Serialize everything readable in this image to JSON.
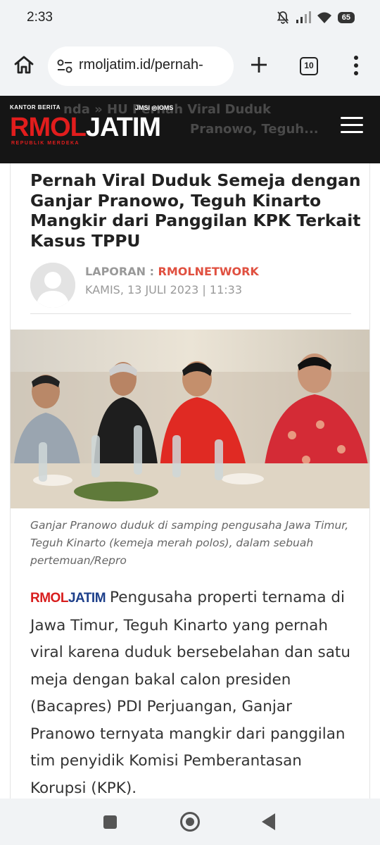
{
  "status_bar": {
    "time": "2:33",
    "battery": "65",
    "icons": [
      "bell-off-icon",
      "signal-icon",
      "wifi-icon",
      "battery-icon"
    ]
  },
  "browser": {
    "url": "rmoljatim.id/pernah-",
    "tab_count": "10",
    "icons": [
      "home-icon",
      "site-settings-icon",
      "new-tab-icon",
      "tabs-icon",
      "more-menu-icon"
    ]
  },
  "site_header": {
    "logo_tagline_top": "KANTOR BERITA",
    "logo_rmol": "RMOL",
    "logo_jatim": "JATIM",
    "logo_tagline_bottom": "REPUBLIK MERDEKA",
    "logo_partner": "JMSI ◎IOMS",
    "breadcrumb_behind": "nda  »  HU       Pernah Viral Duduk",
    "breadcrumb_behind_2": "Pranowo, Teguh...",
    "menu_icon": "hamburger-menu-icon"
  },
  "article": {
    "title": "Pernah Viral Duduk Semeja dengan Ganjar Pranowo, Teguh Kinarto Mangkir dari Panggilan KPK Terkait Kasus TPPU",
    "byline_label": "LAPORAN : ",
    "author": "RMOLNETWORK",
    "date": "KAMIS, 13 JULI 2023 | 11:33",
    "caption": "Ganjar Pranowo duduk di samping pengusaha Jawa Timur, Teguh Kinarto (kemeja merah polos), dalam sebuah pertemuan/Repro",
    "inline_logo_rmol": "RMOL",
    "inline_logo_jatim": "JATIM",
    "body": "Pengusaha properti ternama di Jawa Timur, Teguh Kinarto yang pernah viral karena duduk bersebelahan dan satu meja dengan bakal calon presiden (Bacapres) PDI Perjuangan, Ganjar Pranowo ternyata mangkir dari panggilan tim penyidik Komisi Pemberantasan Korupsi (KPK)."
  },
  "colors": {
    "brand_red": "#e11d1d",
    "brand_blue": "#1d3f8a",
    "header_bg": "#151515",
    "author_color": "#e05040"
  },
  "navbar": {
    "icons": [
      "recents-icon",
      "home-circle-icon",
      "back-icon"
    ]
  }
}
